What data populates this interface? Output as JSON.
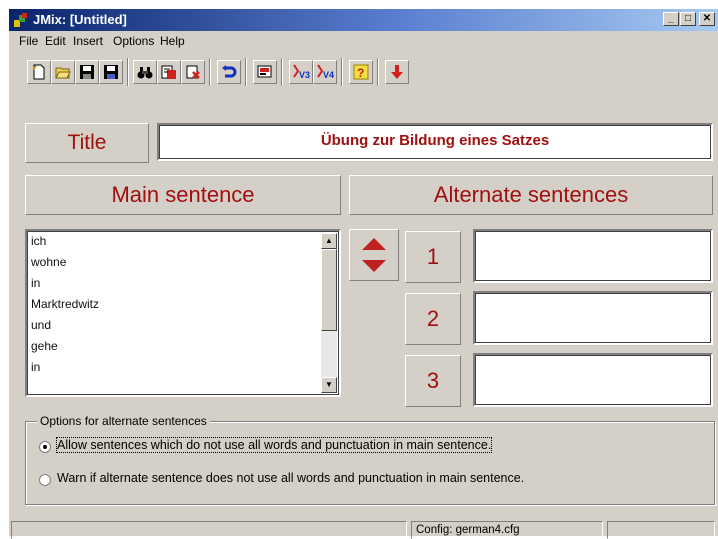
{
  "window": {
    "title": "JMix: [Untitled]",
    "controls": {
      "minimize": "_",
      "maximize": "□",
      "close": "✕"
    }
  },
  "menu": [
    "File",
    "Edit",
    "Insert",
    "Options",
    "Help"
  ],
  "toolbar": {
    "icons": [
      "new-icon",
      "open-icon",
      "save-icon",
      "save-as-icon",
      "find-icon",
      "find-replace-icon",
      "delete-icon",
      "undo-icon",
      "export-icon",
      "v3-icon",
      "v4-icon",
      "help-icon",
      "down-arrow-icon"
    ],
    "v3_label": "V3",
    "v4_label": "V4",
    "help_label": "?"
  },
  "title": {
    "label": "Title",
    "value": "Übung zur Bildung eines Satzes"
  },
  "main": {
    "header": "Main sentence",
    "words": [
      "ich",
      "wohne",
      "in",
      "Marktredwitz",
      "und",
      "gehe",
      "in"
    ]
  },
  "alternates": {
    "header": "Alternate sentences",
    "numbers": [
      "1",
      "2",
      "3"
    ],
    "values": [
      "",
      "",
      ""
    ]
  },
  "options": {
    "legend": "Options for alternate sentences",
    "choices": [
      {
        "label": "Allow sentences which do not use all words and punctuation in main sentence.",
        "selected": true
      },
      {
        "label": "Warn if alternate sentence does not use all words and punctuation in main sentence.",
        "selected": false
      }
    ]
  },
  "statusbar": {
    "left": "",
    "config": "Config: german4.cfg",
    "right": ""
  },
  "colors": {
    "accent_red": "#a01010",
    "titlebar_start": "#0a246a",
    "face": "#d4d0c8"
  }
}
